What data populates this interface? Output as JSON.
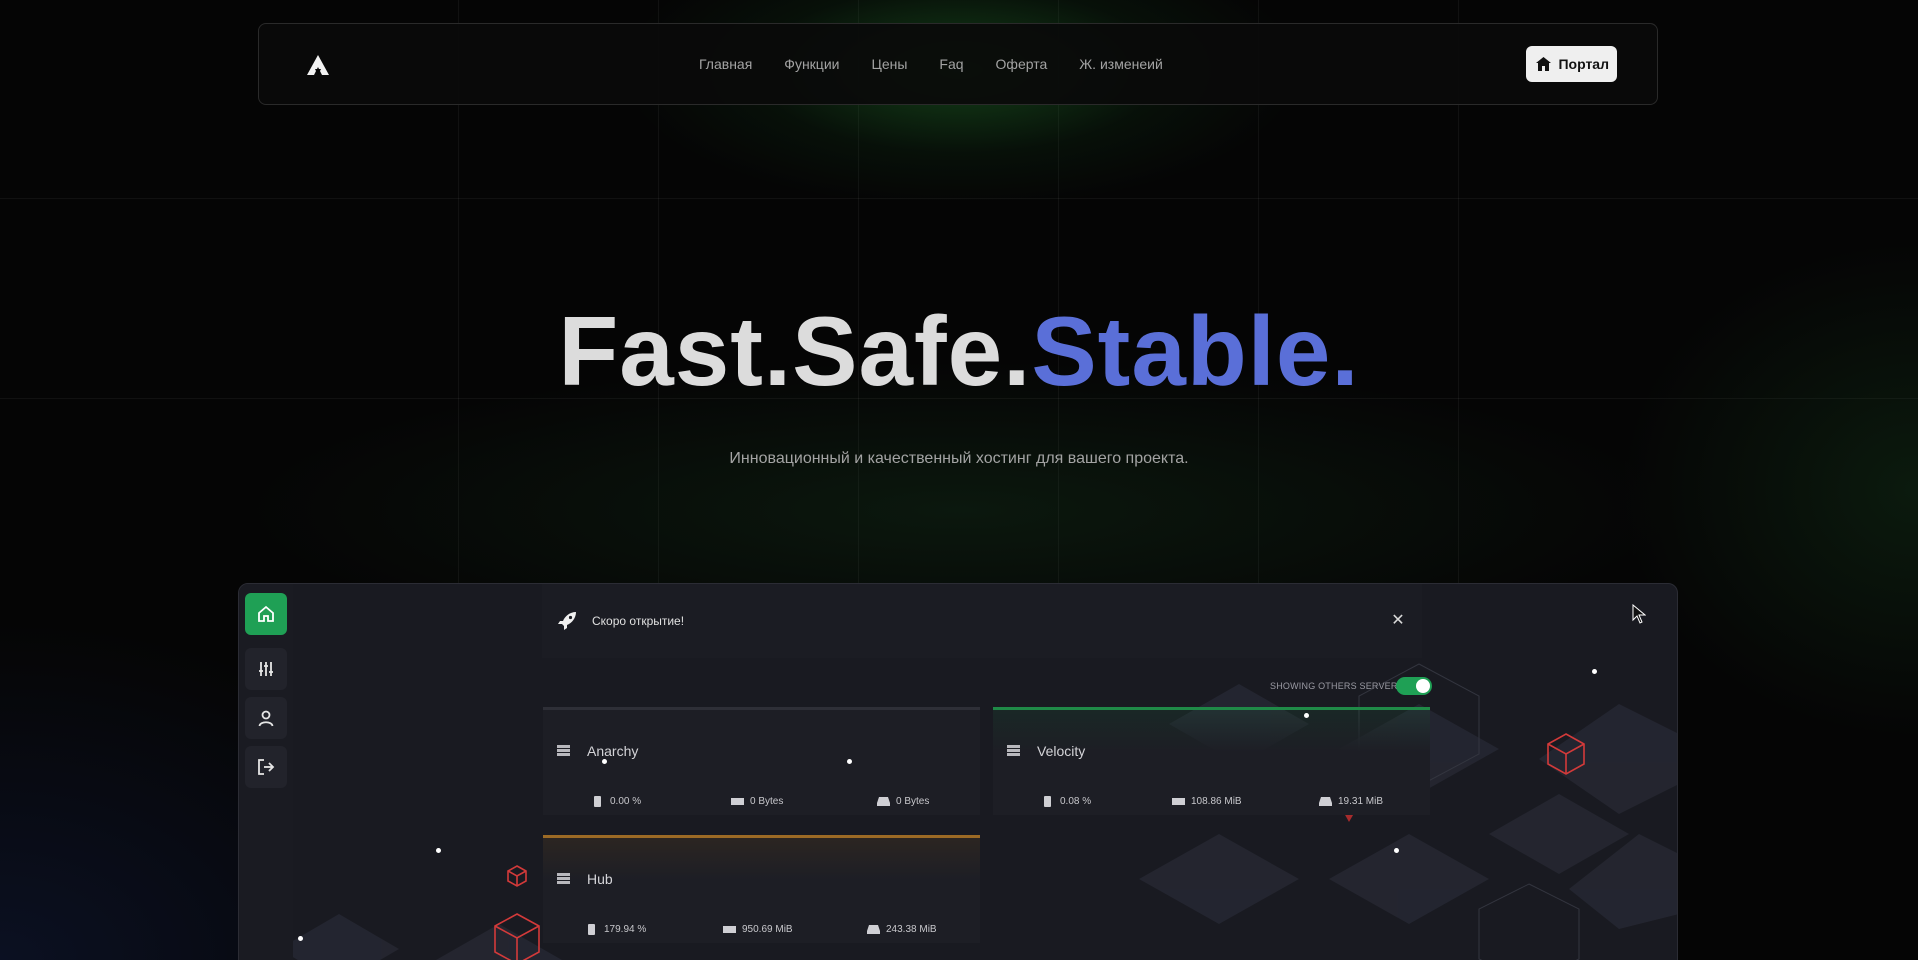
{
  "nav": {
    "links": [
      "Главная",
      "Функции",
      "Цены",
      "Faq",
      "Оферта",
      "Ж. изменеий"
    ],
    "portal_label": "Портал"
  },
  "hero": {
    "title_white": "Fast.Safe.",
    "title_blue": "Stable.",
    "subtitle": "Инновационный и качественный хостинг для вашего проекта."
  },
  "dashboard": {
    "notice": "Скоро открытие!",
    "toggle_label": "SHOWING OTHERS SERVERS",
    "toggle_on": true,
    "servers": [
      {
        "name": "Anarchy",
        "cpu": "0.00 %",
        "memory": "0 Bytes",
        "disk": "0 Bytes"
      },
      {
        "name": "Velocity",
        "cpu": "0.08 %",
        "memory": "108.86 MiB",
        "disk": "19.31 MiB"
      },
      {
        "name": "Hub",
        "cpu": "179.94 %",
        "memory": "950.69 MiB",
        "disk": "243.38 MiB"
      }
    ]
  },
  "colors": {
    "accent_green": "#1fa055",
    "title_blue": "#5a6fd8",
    "card_orange": "#9c6a25"
  },
  "icons": {
    "sidebar": [
      "home-icon",
      "sliders-icon",
      "user-icon",
      "logout-icon"
    ],
    "notice": "rocket-icon",
    "stats": [
      "cpu-icon",
      "memory-icon",
      "disk-icon"
    ]
  }
}
